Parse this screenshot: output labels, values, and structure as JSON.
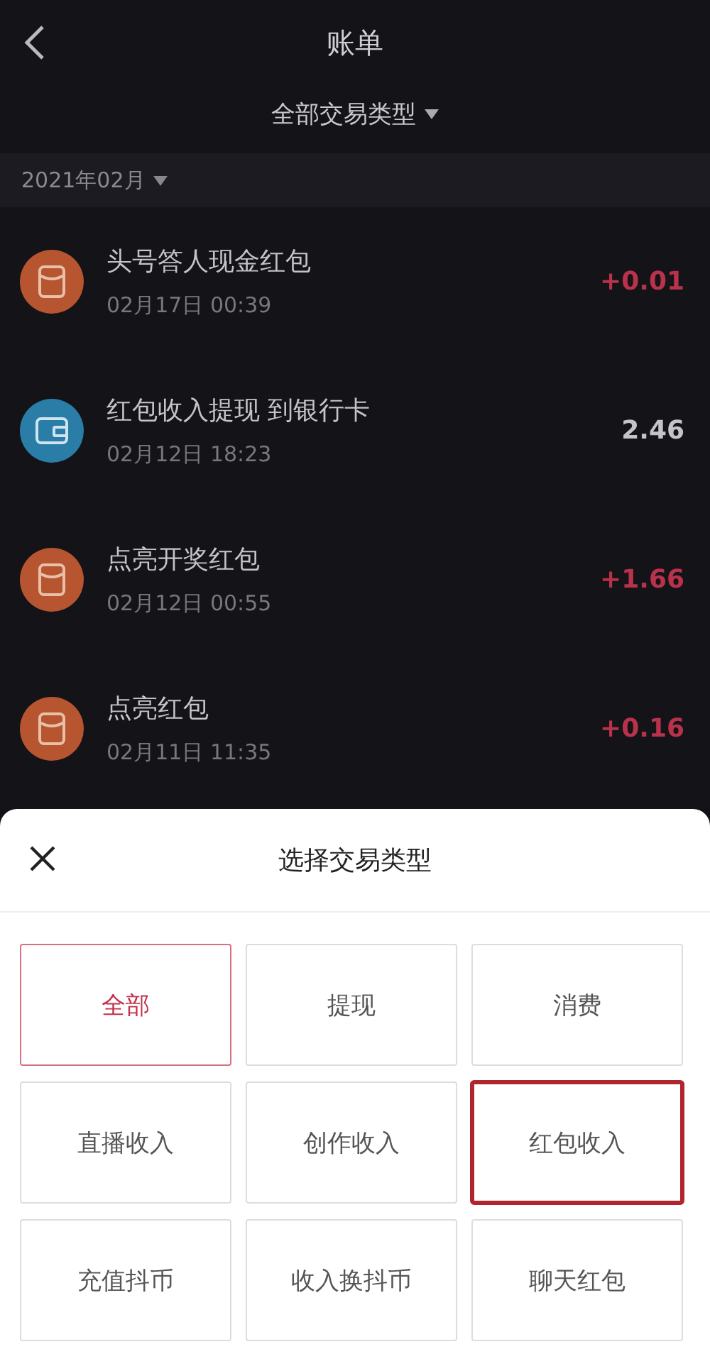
{
  "header": {
    "title": "账单",
    "filter": "全部交易类型"
  },
  "month": "2021年02月",
  "transactions": [
    {
      "kind": "red-packet",
      "title": "头号答人现金红包",
      "date": "02月17日 00:39",
      "amount": "+0.01",
      "income": true
    },
    {
      "kind": "wallet",
      "title": "红包收入提现 到银行卡",
      "date": "02月12日 18:23",
      "amount": "2.46",
      "income": false
    },
    {
      "kind": "red-packet",
      "title": "点亮开奖红包",
      "date": "02月12日 00:55",
      "amount": "+1.66",
      "income": true
    },
    {
      "kind": "red-packet",
      "title": "点亮红包",
      "date": "02月11日 11:35",
      "amount": "+0.16",
      "income": true
    }
  ],
  "sheet": {
    "title": "选择交易类型",
    "options": [
      {
        "label": "全部",
        "selected": true,
        "highlighted": false
      },
      {
        "label": "提现",
        "selected": false,
        "highlighted": false
      },
      {
        "label": "消费",
        "selected": false,
        "highlighted": false
      },
      {
        "label": "直播收入",
        "selected": false,
        "highlighted": false
      },
      {
        "label": "创作收入",
        "selected": false,
        "highlighted": false
      },
      {
        "label": "红包收入",
        "selected": false,
        "highlighted": true
      },
      {
        "label": "充值抖币",
        "selected": false,
        "highlighted": false
      },
      {
        "label": "收入换抖币",
        "selected": false,
        "highlighted": false
      },
      {
        "label": "聊天红包",
        "selected": false,
        "highlighted": false
      }
    ]
  }
}
